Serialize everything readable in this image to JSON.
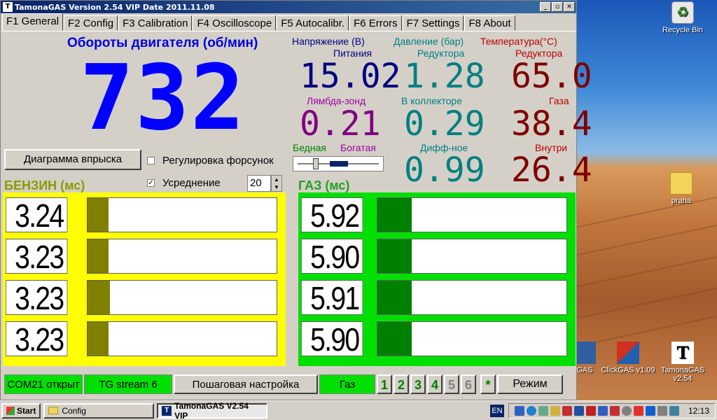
{
  "window": {
    "title": "TamonaGAS  Version 2.54 VIP  Date 2011.11.08"
  },
  "tabs": [
    "F1 General",
    "F2 Config",
    "F3 Calibration",
    "F4 Oscilloscope",
    "F5 Autocalibr.",
    "F6 Errors",
    "F7 Settings",
    "F8 About"
  ],
  "rpm": {
    "title": "Обороты двигателя (об/мин)",
    "value": "732"
  },
  "voltage": {
    "title": "Напряжение (В)",
    "sub": "Питания",
    "value": "15.02"
  },
  "lambda": {
    "title": "Лямбда-зонд",
    "value": "0.21",
    "lean": "Бедная",
    "rich": "Богатая"
  },
  "pressure": {
    "title": "Давление (бар)",
    "reducer_label": "Редуктора",
    "reducer_value": "1.28",
    "collector_label": "В коллекторе",
    "collector_value": "0.29",
    "diff_label": "Дифф-ное",
    "diff_value": "0.99"
  },
  "temperature": {
    "title": "Температура(°C)",
    "reducer_label": "Редуктора",
    "reducer_value": "65.0",
    "gas_label": "Газа",
    "gas_value": "38.4",
    "inside_label": "Внутри",
    "inside_value": "26.4"
  },
  "controls": {
    "injection_button": "Диаграмма впрыска",
    "injector_adjust": "Регулировка форсунок",
    "averaging": "Усреднение",
    "averaging_value": "20"
  },
  "petrol": {
    "title": "БЕНЗИН (мс)",
    "rows": [
      {
        "value": "3.24",
        "fill": 0.11
      },
      {
        "value": "3.23",
        "fill": 0.11
      },
      {
        "value": "3.23",
        "fill": 0.12
      },
      {
        "value": "3.23",
        "fill": 0.11
      }
    ]
  },
  "gas": {
    "title": "ГАЗ (мс)",
    "rows": [
      {
        "value": "5.92",
        "fill": 0.18
      },
      {
        "value": "5.90",
        "fill": 0.18
      },
      {
        "value": "5.91",
        "fill": 0.18
      },
      {
        "value": "5.90",
        "fill": 0.18
      }
    ]
  },
  "status": {
    "com": "COM21 открыт",
    "stream": "TG stream 6",
    "step_setup": "Пошаговая настройка",
    "fuel": "Газ",
    "numbers": [
      "1",
      "2",
      "3",
      "4",
      "5",
      "6"
    ],
    "star": "*",
    "mode": "Режим"
  },
  "desktop": {
    "recycle": "Recycle Bin",
    "folder": "praha",
    "clickgas": "ClickGAS v1.09",
    "tamona": "TamonaGAS v2.54",
    "partial": "GAS"
  },
  "taskbar": {
    "start": "Start",
    "config": "Config",
    "app": "TamonaGAS  V2.54 VIP",
    "lang": "EN",
    "time": "12:13"
  },
  "colors": {
    "rpm": "#0000ff",
    "voltage": "#000080",
    "lambda": "#800080",
    "pressure": "#008080",
    "temperature": "#800000",
    "petrol_frame": "#ffff00",
    "petrol_fill": "#808000",
    "gas_frame": "#00e000",
    "gas_fill": "#008000"
  }
}
